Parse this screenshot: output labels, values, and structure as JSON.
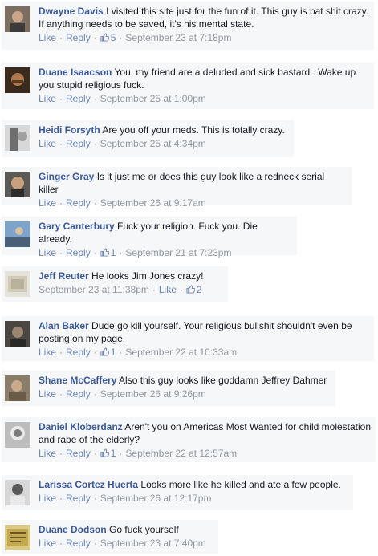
{
  "labels": {
    "like": "Like",
    "reply": "Reply",
    "sep": "·"
  },
  "comments": [
    {
      "author": "Dwayne Davis",
      "text": "I visited this site just for the fun of it. This guy is bat shit crazy. If anything needs to be saved, it's his mental state.",
      "likes": "5",
      "time": "September 23 at 7:18pm"
    },
    {
      "author": "Duane Isaacson",
      "text": "You, my friend are a deluded and sick bastard . Wake up you stupid religious fuck.",
      "likes": "",
      "time": "September 25 at 1:00pm"
    },
    {
      "author": "Heidi Forsyth",
      "text": "Are you off your meds. This is totally crazy.",
      "likes": "",
      "time": "September 25 at 4:34pm"
    },
    {
      "author": "Ginger Gray",
      "text": "Is it just me or does this guy look like a redneck serial killer",
      "likes": "",
      "time": "September 26 at 9:17am"
    },
    {
      "author": "Gary Canterbury",
      "text": "Fuck your religion. Fuck you. Die already.",
      "likes": "1",
      "time": "September 21 at 7:23pm"
    },
    {
      "author": "Jeff Reuter",
      "text": "He looks Jim Jones crazy!",
      "likes": "2",
      "time": "September 23 at 11:38pm"
    },
    {
      "author": "Alan Baker",
      "text": "Dude go kill yourself. Your religious bullshit shouldn't even be posting on my page.",
      "likes": "1",
      "time": "September 22 at 10:33am"
    },
    {
      "author": "Shane McCaffery",
      "text": "Also this guy looks like goddamn Jeffrey Dahmer",
      "likes": "",
      "time": "September 26 at 9:26pm"
    },
    {
      "author": "Daniel Kloberdanz",
      "text": "Aren't you on Americas Most Wanted for child molestation and rape of the elderly?",
      "likes": "1",
      "time": "September 22 at 12:57am"
    },
    {
      "author": "Larissa Cortez Huerta",
      "text": "Looks more like he killed and ate a few people.",
      "likes": "",
      "time": "September 26 at 12:17pm"
    },
    {
      "author": "Duane Dodson",
      "text": "Go fuck yourself",
      "likes": "",
      "time": "September 23 at 7:40pm"
    }
  ],
  "colors": {
    "author": "#3b5998",
    "link": "#6d84b4",
    "meta": "#9197a3",
    "bg": "#f6f7f8"
  }
}
